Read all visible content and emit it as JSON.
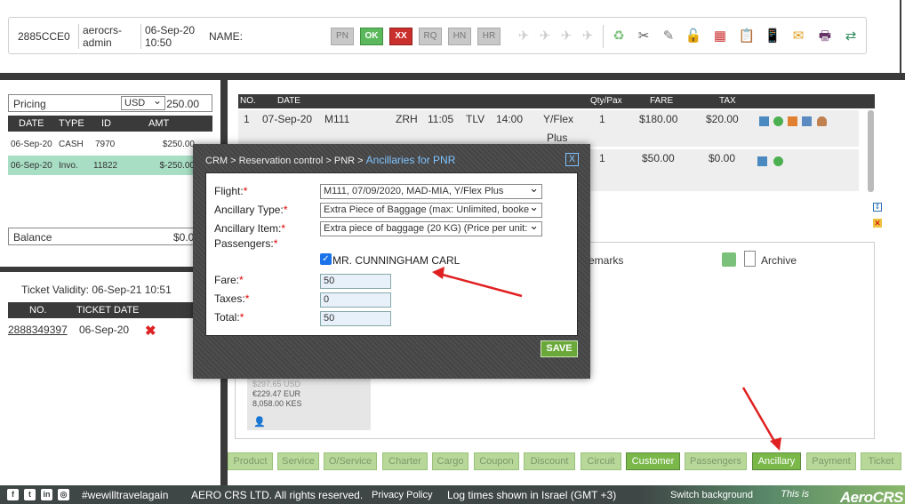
{
  "header": {
    "pnr_code": "2885CCE0",
    "agent_line1": "aerocrs-",
    "agent_line2": "admin",
    "date": "06-Sep-20",
    "time": "10:50",
    "name_label": "NAME:",
    "buttons": [
      "PN",
      "OK",
      "XX",
      "RQ",
      "HN",
      "HR"
    ]
  },
  "pricing": {
    "label": "Pricing",
    "currency": "USD",
    "amount": "250.00",
    "columns": [
      "DATE",
      "TYPE",
      "ID",
      "AMT"
    ],
    "rows": [
      {
        "date": "06-Sep-20",
        "type": "CASH",
        "id": "7970",
        "amt": "$250.00"
      },
      {
        "date": "06-Sep-20",
        "type": "Invo.",
        "id": "11822",
        "amt": "$-250.00"
      }
    ],
    "balance_label": "Balance",
    "balance_value": "$0.0"
  },
  "tickets": {
    "validity_label": "Ticket Validity:",
    "validity_value": "06-Sep-21 10:51",
    "columns": [
      "NO.",
      "TICKET DATE"
    ],
    "rows": [
      {
        "number": "2888349397",
        "date": "06-Sep-20"
      }
    ]
  },
  "segments": {
    "columns": [
      "NO.",
      "DATE",
      "Qty/Pax",
      "FARE",
      "TAX"
    ],
    "rows": [
      {
        "no": "1",
        "date": "07-Sep-20",
        "flight": "M111",
        "from": "ZRH",
        "dep": "11:05",
        "to": "TLV",
        "arr": "14:00",
        "class": "Y/Flex",
        "class2": "Plus",
        "qty": "1",
        "fare": "$180.00",
        "tax": "$20.00"
      },
      {
        "no": "",
        "date": "",
        "flight": "",
        "from": "",
        "dep": "",
        "to": "",
        "arr": "",
        "class": "",
        "class2": "",
        "qty": "1",
        "fare": "$50.00",
        "tax": "$0.00"
      }
    ]
  },
  "remarks": {
    "label": "emarks",
    "archive_label": "Archive"
  },
  "info_card": {
    "line1": "$297.65 USD",
    "line2": "€229.47 EUR",
    "line3": "8,058.00 KES"
  },
  "tabs": [
    "Product",
    "Service",
    "O/Service",
    "Charter",
    "Cargo",
    "Coupon",
    "Discount",
    "Circuit",
    "Customer",
    "Passengers",
    "Ancillary",
    "Payment",
    "Ticket"
  ],
  "footer": {
    "hashtag": "#wewilltravelagain",
    "copyright": "AERO CRS LTD. All rights reserved.",
    "privacy": "Privacy Policy",
    "log_times": "Log times shown in Israel (GMT +3)",
    "switch_bg": "Switch background",
    "brand_prefix": "This is",
    "brand": "AeroCRS"
  },
  "modal": {
    "breadcrumb": "CRM > Reservation control > PNR >",
    "title": "Ancillaries for PNR",
    "close": "X",
    "flight_label": "Flight:",
    "flight_value": "M111, 07/09/2020, MAD-MIA, Y/Flex Plus",
    "type_label": "Ancillary Type:",
    "type_value": "Extra Piece of Baggage (max: Unlimited, booke",
    "item_label": "Ancillary Item:",
    "item_value": "Extra piece of baggage (20 KG) (Price per unit:",
    "passengers_label": "Passengers:",
    "passenger_name": "MR. CUNNINGHAM CARL",
    "fare_label": "Fare:",
    "fare_value": "50",
    "taxes_label": "Taxes:",
    "taxes_value": "0",
    "total_label": "Total:",
    "total_value": "50",
    "save_label": "SAVE",
    "required_mark": "*"
  },
  "colors": {
    "accent_blue": "#2a6fb5",
    "active_tab": "#7ab84a",
    "inactive_tab": "#b8d89a",
    "highlight_row": "#a8dfc4",
    "arrow_red": "#e02020"
  }
}
